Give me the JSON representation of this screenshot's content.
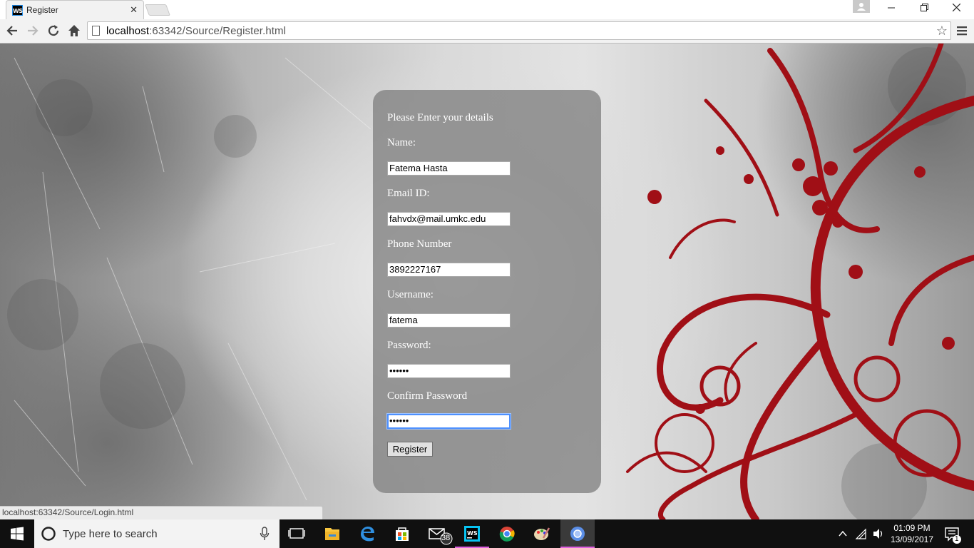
{
  "browser": {
    "tab_title": "Register",
    "tab_favicon_text": "WS",
    "url_host": "localhost",
    "url_rest": ":63342/Source/Register.html"
  },
  "form": {
    "heading": "Please Enter your details",
    "name_label": "Name:",
    "name_value": "Fatema Hasta",
    "email_label": "Email ID:",
    "email_value": "fahvdx@mail.umkc.edu",
    "phone_label": "Phone Number",
    "phone_value": "3892227167",
    "username_label": "Username:",
    "username_value": "fatema",
    "password_label": "Password:",
    "password_value": "••••••",
    "confirm_label": "Confirm Password",
    "confirm_value": "••••••",
    "submit_label": "Register"
  },
  "status_bar": {
    "link": "localhost:63342/Source/Login.html"
  },
  "taskbar": {
    "search_placeholder": "Type here to search",
    "mail_badge": "38",
    "clock_time": "01:09 PM",
    "clock_date": "13/09/2017",
    "notification_count": "1"
  },
  "colors": {
    "accent_red": "#a00f16",
    "panel": "#808080",
    "focus": "#4d90fe"
  },
  "icons": [
    "chrome-favicon",
    "back-icon",
    "forward-icon",
    "reload-icon",
    "home-icon",
    "star-icon",
    "menu-icon",
    "windows-icon",
    "cortana-icon",
    "mic-icon",
    "task-view-icon",
    "file-explorer-icon",
    "edge-icon",
    "store-icon",
    "mail-icon",
    "webstorm-icon",
    "chrome-icon",
    "paint-icon",
    "chromium-icon",
    "chevron-up-icon",
    "wifi-icon",
    "notification-icon"
  ]
}
